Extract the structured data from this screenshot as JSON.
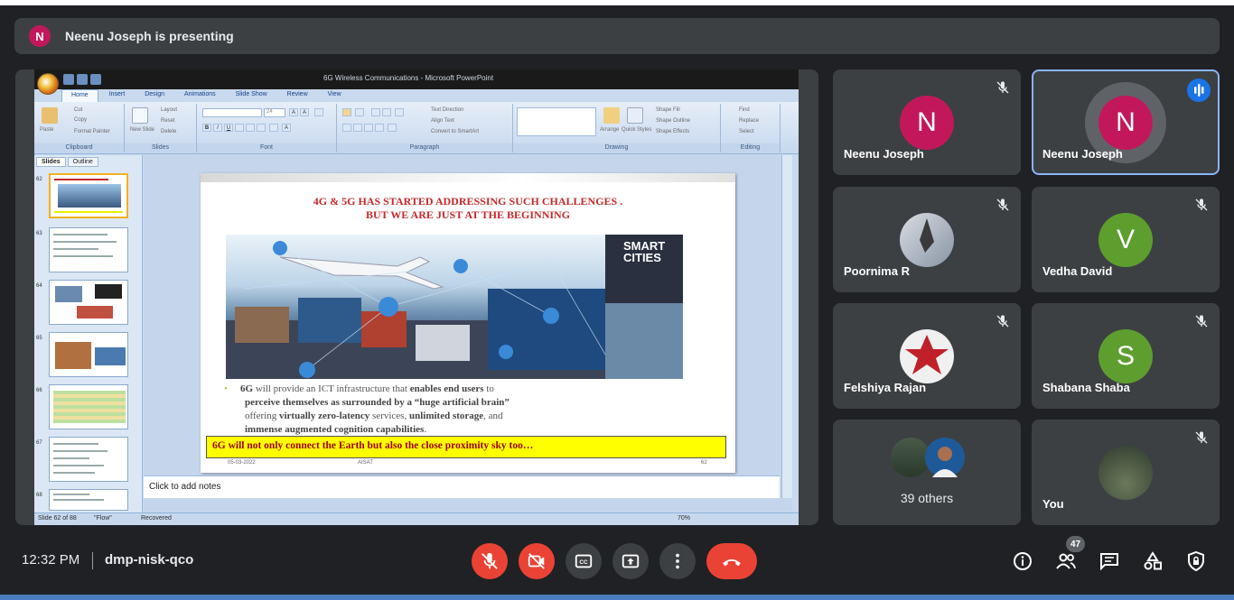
{
  "banner": {
    "avatar_letter": "N",
    "text": "Neenu Joseph is presenting"
  },
  "ppt": {
    "window_title": "6G Wireless Communications - Microsoft PowerPoint",
    "tabs": [
      "Home",
      "Insert",
      "Design",
      "Animations",
      "Slide Show",
      "Review",
      "View"
    ],
    "ribbon": {
      "clipboard": {
        "paste": "Paste",
        "cut": "Cut",
        "copy": "Copy",
        "format_painter": "Format Painter",
        "label": "Clipboard"
      },
      "slides": {
        "new_slide": "New Slide",
        "layout": "Layout",
        "reset": "Reset",
        "delete": "Delete",
        "label": "Slides"
      },
      "font": {
        "size": "24",
        "label": "Font"
      },
      "paragraph": {
        "text_direction": "Text Direction",
        "align_text": "Align Text",
        "convert": "Convert to SmartArt",
        "label": "Paragraph"
      },
      "drawing": {
        "arrange": "Arrange",
        "quick_styles": "Quick Styles",
        "shape_fill": "Shape Fill",
        "shape_outline": "Shape Outline",
        "shape_effects": "Shape Effects",
        "label": "Drawing"
      },
      "editing": {
        "find": "Find",
        "replace": "Replace",
        "select": "Select",
        "label": "Editing"
      }
    },
    "pane_tabs": [
      "Slides",
      "Outline"
    ],
    "thumb_numbers": [
      "62",
      "63",
      "64",
      "65",
      "66",
      "67",
      "68"
    ],
    "slide": {
      "heading_line1": "4G & 5G HAS STARTED ADDRESSING SUCH CHALLENGES .",
      "heading_line2": "BUT WE ARE JUST AT THE BEGINNING",
      "smart_cities": "SMART CITIES",
      "bullet": {
        "p1": "6G",
        "p2": " will provide an ICT infrastructure that ",
        "p3": "enables end users",
        "p4": " to",
        "p5": "perceive themselves as surrounded by a “huge artificial brain”",
        "p6": "offering ",
        "p7": "virtually zero-latency",
        "p8": " services, ",
        "p9": "unlimited storage",
        "p10": ", and",
        "p11": "immense augmented cognition capabilities",
        "p12": "."
      },
      "highlight": "6G will not only connect the Earth but also the close proximity sky too…",
      "footer_date": "05-03-2022",
      "footer_center": "AISAT",
      "footer_page": "62"
    },
    "notes_placeholder": "Click to add notes",
    "status": {
      "slide_info": "Slide 62 of 88",
      "theme": "\"Flow\"",
      "recovered": "Recovered",
      "zoom": "70%"
    }
  },
  "participants": [
    {
      "name": "Neenu Joseph",
      "letter": "N",
      "color": "#c2185b"
    },
    {
      "name": "Neenu Joseph",
      "letter": "N",
      "color": "#c2185b"
    },
    {
      "name": "Poornima R"
    },
    {
      "name": "Vedha David",
      "letter": "V",
      "color": "#5e9e2f"
    },
    {
      "name": "Felshiya Rajan"
    },
    {
      "name": "Shabana Shaba",
      "letter": "S",
      "color": "#5e9e2f"
    },
    {
      "name": "39 others"
    },
    {
      "name": "You"
    }
  ],
  "bottom": {
    "time": "12:32 PM",
    "meeting_code": "dmp-nisk-qco",
    "participant_count": "47"
  },
  "colors": {
    "danger": "#ea4335",
    "tile": "#3c4043",
    "bg": "#202124",
    "accent": "#8ab4f8"
  }
}
